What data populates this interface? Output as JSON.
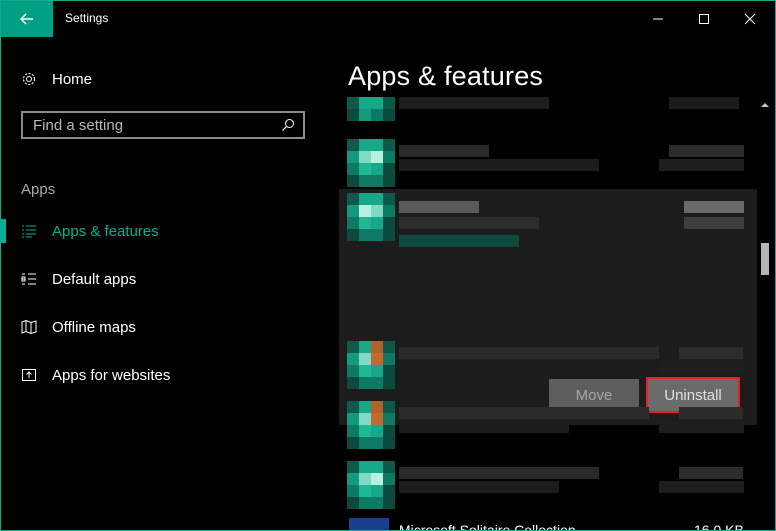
{
  "window": {
    "title": "Settings"
  },
  "sidebar": {
    "home_label": "Home",
    "search_placeholder": "Find a setting",
    "group_header": "Apps",
    "items": [
      {
        "label": "Apps & features",
        "icon": "list-icon",
        "active": true
      },
      {
        "label": "Default apps",
        "icon": "default-apps-icon",
        "active": false
      },
      {
        "label": "Offline maps",
        "icon": "map-icon",
        "active": false
      },
      {
        "label": "Apps for websites",
        "icon": "open-in-app-icon",
        "active": false
      }
    ]
  },
  "main": {
    "title": "Apps & features",
    "move_button": "Move",
    "uninstall_button": "Uninstall",
    "last_app_name": "Microsoft Solitaire Collection",
    "last_app_size": "16.0 KB"
  },
  "colors": {
    "accent": "#00b294",
    "highlight_border": "#ec1c24"
  }
}
